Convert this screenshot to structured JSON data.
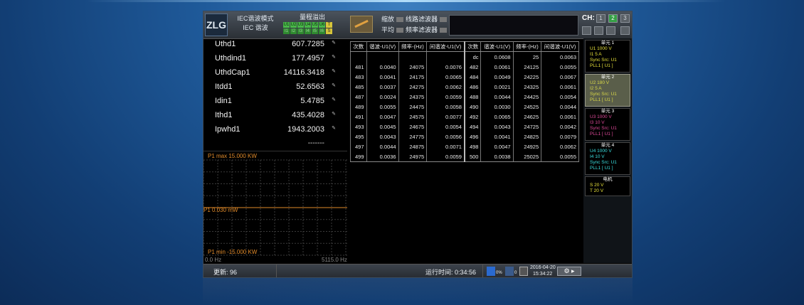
{
  "header": {
    "logo": "ZLG",
    "mode_line1": "IEC谐波模式",
    "mode_line2": "IEC 谐波",
    "range_title": "量程溢出",
    "voltage_chips": [
      "U1",
      "U2",
      "U3",
      "U4",
      "U5",
      "U6",
      "T"
    ],
    "current_chips": [
      "I1",
      "I2",
      "I3",
      "I4",
      "I5",
      "I6",
      "S"
    ],
    "filter_row1_left": "缩放",
    "filter_row1_right": "线路滤波器",
    "filter_row2_left": "平均",
    "filter_row2_right": "频率滤波器",
    "ch_label": "CH:",
    "ch_buttons": [
      "1",
      "2",
      "3"
    ],
    "colors": {
      "chip_green": "#48b848",
      "chip_yellow": "#d6c43a"
    }
  },
  "measurements": [
    {
      "name": "Uthd1",
      "value": "607.7285",
      "icon": "✎"
    },
    {
      "name": "Uthdind1",
      "value": "177.4957",
      "icon": "✎"
    },
    {
      "name": "UthdCap1",
      "value": "14116.3418",
      "icon": "✎"
    },
    {
      "name": "Itdd1",
      "value": "52.6563",
      "icon": "✎"
    },
    {
      "name": "Idin1",
      "value": "5.4785",
      "icon": "✎"
    },
    {
      "name": "Ithd1",
      "value": "435.4028",
      "icon": "✎"
    },
    {
      "name": "Ipwhd1",
      "value": "1943.2003",
      "icon": "✎"
    }
  ],
  "empty_values": [
    "-------",
    "-------"
  ],
  "graph": {
    "max_label": "P1   max 15.000 KW",
    "center_label": "P1 0.030 mW",
    "min_label": "P1   min -15.000 KW",
    "x_start": "0.0 Hz",
    "x_end": "5115.0 Hz",
    "color": "#e08a2a"
  },
  "harmonic_table": {
    "headers": [
      "次数",
      "谐波-U1(V)",
      "频率-(Hz)",
      "间谐波-U1(V)",
      "次数",
      "谐波-U1(V)",
      "频率-(Hz)",
      "间谐波-U1(V)"
    ],
    "rows": [
      [
        "",
        "",
        "",
        "",
        "dc",
        "0.0608",
        "25",
        "0.0063"
      ],
      [
        "481",
        "0.0040",
        "24075",
        "0.0076",
        "482",
        "0.0061",
        "24125",
        "0.0055"
      ],
      [
        "483",
        "0.0041",
        "24175",
        "0.0065",
        "484",
        "0.0049",
        "24225",
        "0.0067"
      ],
      [
        "485",
        "0.0037",
        "24275",
        "0.0062",
        "486",
        "0.0021",
        "24325",
        "0.0061"
      ],
      [
        "487",
        "0.0024",
        "24375",
        "0.0059",
        "488",
        "0.0044",
        "24425",
        "0.0054"
      ],
      [
        "489",
        "0.0055",
        "24475",
        "0.0058",
        "490",
        "0.0030",
        "24525",
        "0.0044"
      ],
      [
        "491",
        "0.0047",
        "24575",
        "0.0077",
        "492",
        "0.0065",
        "24625",
        "0.0061"
      ],
      [
        "493",
        "0.0045",
        "24675",
        "0.0054",
        "494",
        "0.0043",
        "24725",
        "0.0042"
      ],
      [
        "495",
        "0.0043",
        "24775",
        "0.0056",
        "496",
        "0.0041",
        "24825",
        "0.0079"
      ],
      [
        "497",
        "0.0044",
        "24875",
        "0.0071",
        "498",
        "0.0047",
        "24925",
        "0.0062"
      ],
      [
        "499",
        "0.0036",
        "24975",
        "0.0059",
        "500",
        "0.0038",
        "25025",
        "0.0055"
      ]
    ]
  },
  "units": [
    {
      "title": "单元 1",
      "color": "#e8e23a",
      "lines": [
        "U1    1000 V",
        "I1         5 A",
        "Sync Src: U1",
        "PLL1 [ U1 ]"
      ]
    },
    {
      "title": "单元 2",
      "color": "#d8d848",
      "lines": [
        "U2     180 V",
        "I2         5 A",
        "Sync Src: U1",
        "PLL1 [ U1 ]"
      ]
    },
    {
      "title": "单元 3",
      "color": "#e04a9a",
      "lines": [
        "U3   1000 V",
        "I3       10 V",
        "Sync Src: U1",
        "PLL1 [ U1 ]"
      ]
    },
    {
      "title": "单元 4",
      "color": "#3ae0e0",
      "lines": [
        "U4   1000 V",
        "I4       10 V",
        "Sync Src: U1",
        "PLL1 [ U1 ]"
      ]
    },
    {
      "title": "电机",
      "color": "#e8e23a",
      "lines": [
        "S        20 V",
        "T        20 V"
      ]
    }
  ],
  "status": {
    "update_label": "更新: 96",
    "runtime_label": "运行时间: 0:34:56",
    "disk1": "0%",
    "disk2": "0",
    "date": "2016-04-20",
    "time": "15:34:22",
    "settings": "⚙ ▸"
  }
}
